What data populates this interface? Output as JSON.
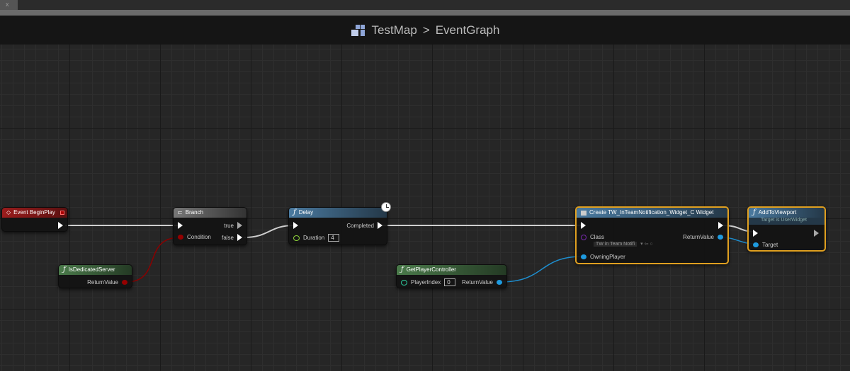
{
  "tab": {
    "close": "x"
  },
  "breadcrumb": {
    "map": "TestMap",
    "separator": ">",
    "graph": "EventGraph"
  },
  "nodes": {
    "begin_play": {
      "title": "Event BeginPlay"
    },
    "branch": {
      "title": "Branch",
      "condition": "Condition",
      "true": "true",
      "false": "false"
    },
    "delay": {
      "title": "Delay",
      "completed": "Completed",
      "duration_label": "Duration",
      "duration_value": "4"
    },
    "is_dedicated": {
      "title": "IsDedicatedServer",
      "return": "ReturnValue"
    },
    "get_pc": {
      "title": "GetPlayerController",
      "player_index_label": "PlayerIndex",
      "player_index_value": "0",
      "return": "ReturnValue"
    },
    "create_widget": {
      "title": "Create TW_InTeamNotification_Widget_C Widget",
      "class_label": "Class",
      "class_value": "TW in Team Notifi",
      "return": "ReturnValue",
      "owning": "OwningPlayer"
    },
    "add_viewport": {
      "title": "AddToViewport",
      "subtitle": "Target is UserWidget",
      "target": "Target"
    }
  },
  "colors": {
    "event": "#8a1a1a",
    "function": "#3f6a88",
    "pure": "#3f6a3f",
    "exec": "#ffffff",
    "bool": "#950000",
    "object": "#1e9be0",
    "selected": "#e0a020"
  }
}
